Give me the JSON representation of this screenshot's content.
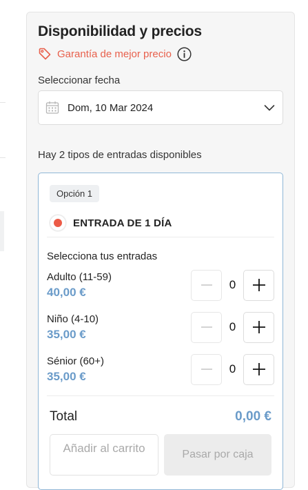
{
  "panel": {
    "title": "Disponibilidad y precios",
    "guarantee": {
      "icon": "price-tag-icon",
      "text": "Garantía de mejor precio",
      "info_icon": "info-icon",
      "color": "#e8604c"
    },
    "date": {
      "label": "Seleccionar fecha",
      "value": "Dom, 10 Mar 2024",
      "icon": "calendar-icon",
      "chevron": "chevron-down-icon"
    },
    "available_text": "Hay 2 tipos de entradas disponibles"
  },
  "option": {
    "badge": "Opción 1",
    "ticket_type": "ENTRADA DE 1 DÍA",
    "radio_selected": true,
    "select_label": "Selecciona tus entradas",
    "rows": [
      {
        "name": "Adulto (11-59)",
        "price": "40,00 €",
        "quantity": "0"
      },
      {
        "name": "Niño (4-10)",
        "price": "35,00 €",
        "quantity": "0"
      },
      {
        "name": "Sénior (60+)",
        "price": "35,00 €",
        "quantity": "0"
      }
    ],
    "total_label": "Total",
    "total_value": "0,00 €",
    "add_to_cart_label": "Añadir al carrito",
    "checkout_label": "Pasar por caja"
  },
  "colors": {
    "accent": "#ec5b47",
    "price": "#6a9bc9",
    "card_border": "#8fb6d6"
  }
}
